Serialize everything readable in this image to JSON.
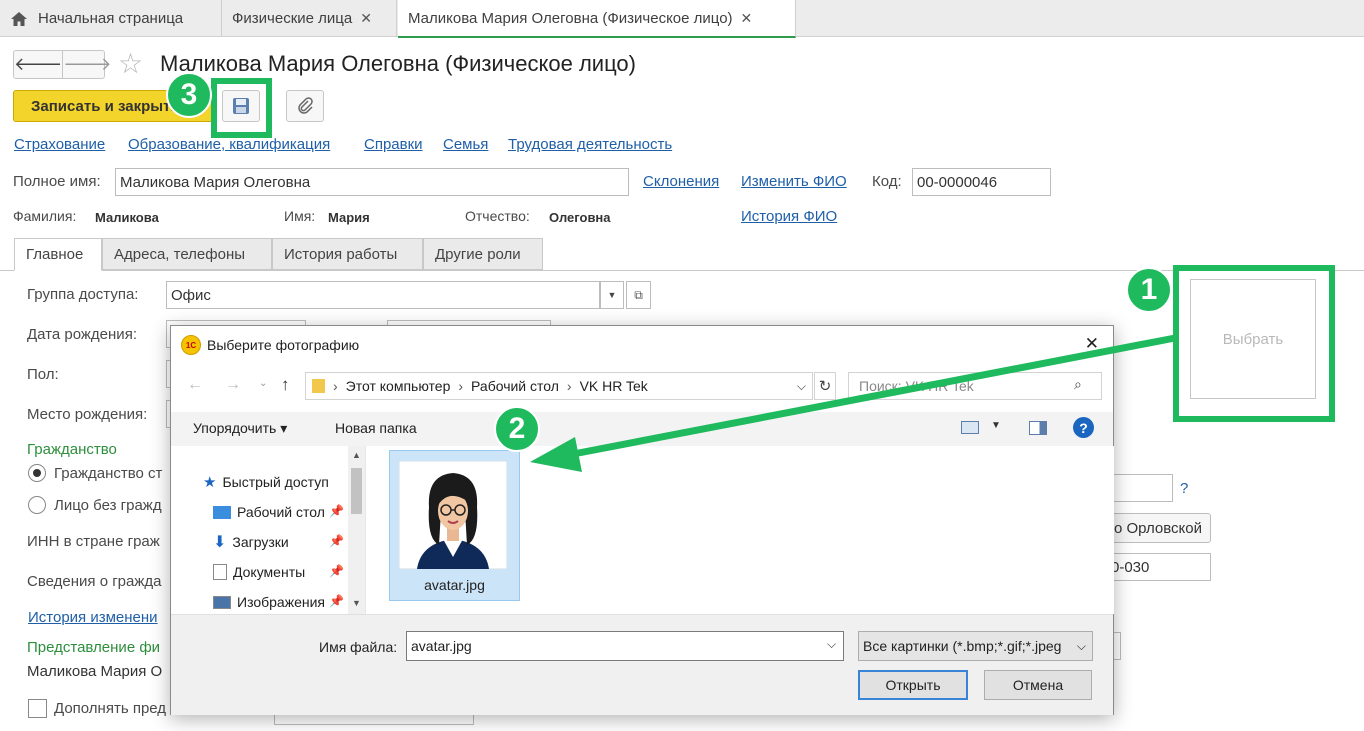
{
  "tabs": {
    "home": "Начальная страница",
    "individuals": "Физические лица",
    "current": "Маликова Мария Олеговна (Физическое лицо)",
    "close_glyph": "✕"
  },
  "form": {
    "title": "Маликова Мария Олеговна (Физическое лицо)",
    "save_close": "Записать и закрыть",
    "links": [
      "Страхование",
      "Образование, квалификация",
      "Справки",
      "Семья",
      "Трудовая деятельность"
    ],
    "full_name_label": "Полное имя:",
    "full_name_value": "Маликова Мария Олеговна",
    "declensions": "Склонения",
    "change_name": "Изменить ФИО",
    "code_label": "Код:",
    "code_value": "00-0000046",
    "surname_label": "Фамилия:",
    "surname_value": "Маликова",
    "name_label": "Имя:",
    "name_value": "Мария",
    "patronymic_label": "Отчество:",
    "patronymic_value": "Олеговна",
    "name_history": "История ФИО",
    "subtabs": [
      "Главное",
      "Адреса, телефоны",
      "История работы",
      "Другие роли"
    ],
    "access_group_label": "Группа доступа:",
    "access_group_value": "Офис",
    "birth_date_label": "Дата рождения:",
    "gender_label": "Пол:",
    "birth_place_label": "Место рождения:",
    "citizenship_title": "Гражданство",
    "citizenship_option1": "Гражданство ст",
    "citizenship_option2": "Лицо без гражд",
    "inn_label": "ИНН в стране граж",
    "info_label": "Сведения о гражда",
    "change_history": "История изменени",
    "representation_title": "Представление фи",
    "representation_value": "Маликова Мария О",
    "supplement_label": "Дополнять пред",
    "question": "?",
    "orel_value": "о Орловской",
    "code030": "0-030",
    "photo_select": "Выбрать"
  },
  "dialog": {
    "title": "Выберите фотографию",
    "close": "✕",
    "breadcrumb": [
      "Этот компьютер",
      "Рабочий стол",
      "VK HR Tek"
    ],
    "search_placeholder": "Поиск: VK HR Tek",
    "organize": "Упорядочить",
    "new_folder": "Новая папка",
    "nav_items": [
      {
        "label": "Быстрый доступ",
        "icon": "star-icon"
      },
      {
        "label": "Рабочий стол",
        "icon": "desktop-icon"
      },
      {
        "label": "Загрузки",
        "icon": "download-icon"
      },
      {
        "label": "Документы",
        "icon": "document-icon"
      },
      {
        "label": "Изображения",
        "icon": "pictures-icon"
      }
    ],
    "file_name": "avatar.jpg",
    "file_name_label": "Имя файла:",
    "file_name_value": "avatar.jpg",
    "file_type": "Все картинки (*.bmp;*.gif;*.jpeg",
    "open": "Открыть",
    "cancel": "Отмена"
  },
  "callouts": {
    "one": "1",
    "two": "2",
    "three": "3"
  },
  "colors": {
    "accent_green": "#1fba5e",
    "link_blue": "#1f5fa8",
    "save_yellow": "#f3d42b"
  }
}
